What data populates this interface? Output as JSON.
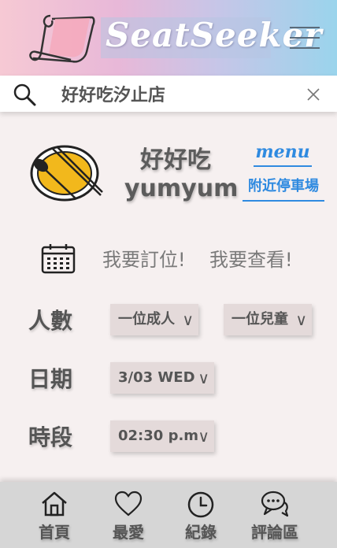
{
  "header": {
    "brand": "SeatSeeker",
    "logo_icon": "scroll-seat-icon",
    "menu_icon": "hamburger-menu-icon"
  },
  "search": {
    "value": "好好吃汐止店",
    "search_icon": "search-icon",
    "clear_icon": "close-icon"
  },
  "restaurant": {
    "logo_icon": "plate-spoon-chopsticks-icon",
    "name_zh": "好好吃",
    "name_en": "yumyum",
    "menu_link": "menu",
    "parking_link": "附近停車場"
  },
  "actions": {
    "calendar_icon": "calendar-icon",
    "reserve": "我要訂位!",
    "view": "我要查看!"
  },
  "form": {
    "party_label": "人數",
    "adults": "一位成人",
    "children": "一位兒童",
    "date_label": "日期",
    "date": "3/03 WED",
    "time_label": "時段",
    "time": "02:30 p.m",
    "arrow": "∨"
  },
  "bottom_nav": [
    {
      "label": "首頁",
      "icon": "home-icon"
    },
    {
      "label": "最愛",
      "icon": "heart-icon"
    },
    {
      "label": "紀錄",
      "icon": "clock-icon"
    },
    {
      "label": "評論區",
      "icon": "chat-bubbles-icon"
    }
  ],
  "colors": {
    "link": "#2f8ae0",
    "background": "#f6f0f0",
    "select_bg": "#e4dada",
    "nav_bg": "#d6d6d6",
    "plate_fill": "#f2b81c"
  }
}
